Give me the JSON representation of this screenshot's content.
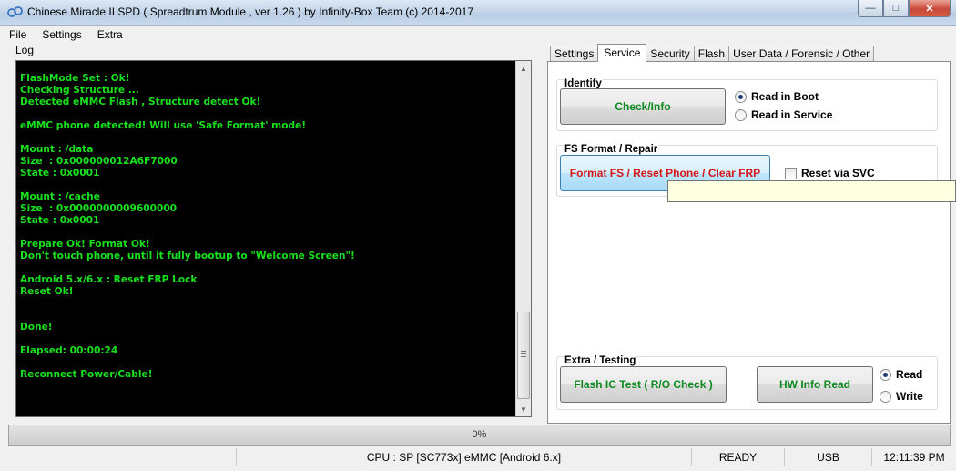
{
  "window": {
    "title": "Chinese Miracle II SPD ( Spreadtrum Module , ver 1.26 ) by Infinity-Box Team (c) 2014-2017",
    "controls": {
      "minimize": "—",
      "maximize": "□",
      "close": "✕"
    }
  },
  "menu": {
    "items": [
      "File",
      "Settings",
      "Extra"
    ]
  },
  "log": {
    "label": "Log",
    "lines": [
      "FlashMode Set : Ok!",
      "Checking Structure ...",
      "Detected eMMC Flash , Structure detect Ok!",
      "",
      "eMMC phone detected! Will use 'Safe Format' mode!",
      "",
      "Mount : /data",
      "Size  : 0x000000012A6F7000",
      "State : 0x0001",
      "",
      "Mount : /cache",
      "Size  : 0x0000000009600000",
      "State : 0x0001",
      "",
      "Prepare Ok! Format Ok!",
      "Don't touch phone, until it fully bootup to \"Welcome Screen\"!",
      "",
      "Android 5.x/6.x : Reset FRP Lock",
      "Reset Ok!",
      "",
      "",
      "Done!",
      "",
      "Elapsed: 00:00:24",
      "",
      "Reconnect Power/Cable!"
    ],
    "text_color": "#19e01e"
  },
  "tabs": [
    {
      "label": "Settings",
      "active": false
    },
    {
      "label": "Service",
      "active": true
    },
    {
      "label": "Security",
      "active": false
    },
    {
      "label": "Flash",
      "active": false
    },
    {
      "label": "User Data / Forensic / Other",
      "active": false
    }
  ],
  "service": {
    "identify": {
      "title": "Identify",
      "button": "Check/Info",
      "options": [
        {
          "label": "Read in Boot",
          "checked": true
        },
        {
          "label": "Read in Service",
          "checked": false
        }
      ]
    },
    "fs_format": {
      "title": "FS Format / Repair",
      "button": "Format FS / Reset Phone / Clear FRP",
      "checkbox": {
        "label": "Reset via SVC",
        "checked": false
      }
    },
    "extra": {
      "title": "Extra / Testing",
      "flash_button": "Flash IC Test ( R/O Check )",
      "hw_button": "HW Info Read",
      "options": [
        {
          "label": "Read",
          "checked": true
        },
        {
          "label": "Write",
          "checked": false
        }
      ]
    }
  },
  "progress": {
    "value": 0,
    "text": "0%"
  },
  "status": {
    "cpu": "CPU : SP [SC773x] eMMC [Android 6.x]",
    "state": "READY",
    "port": "USB",
    "time": "12:11:39 PM"
  },
  "colors": {
    "accent_green": "#0e8a1f",
    "accent_red": "#d41616",
    "progress_fill": "#37b24a"
  }
}
